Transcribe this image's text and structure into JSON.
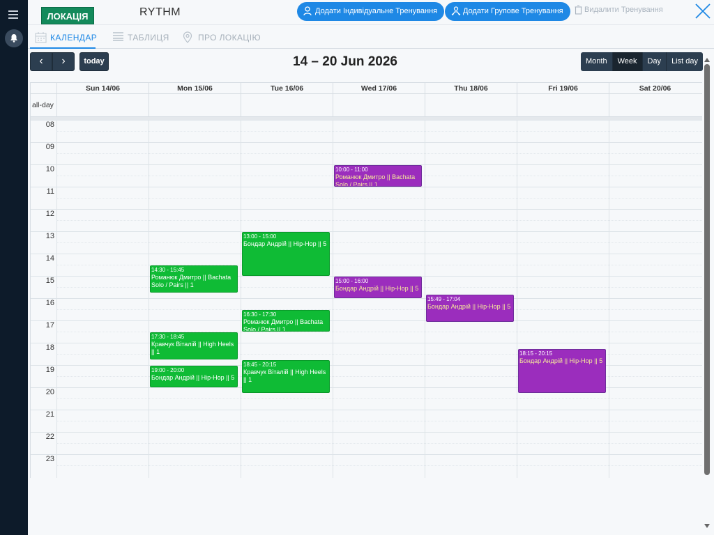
{
  "header": {
    "location_badge": "ЛОКАЦІЯ",
    "app_title": "RYTHM",
    "add_individual": "Додати Індивідуальне Тренування",
    "add_group": "Додати Групове Тренування",
    "delete_training": "Видалити Тренування"
  },
  "tabs": [
    {
      "label": "КАЛЕНДАР",
      "icon": "calendar-icon",
      "active": true
    },
    {
      "label": "ТАБЛИЦЯ",
      "icon": "table-icon",
      "active": false
    },
    {
      "label": "ПРО ЛОКАЦІЮ",
      "icon": "location-pin-icon",
      "active": false
    }
  ],
  "toolbar": {
    "prev": "‹",
    "next": "›",
    "today": "today",
    "title": "14 – 20 Jun 2026",
    "views": [
      "Month",
      "Week",
      "Day",
      "List day"
    ],
    "active_view": "Week"
  },
  "calendar": {
    "allday_label": "all-day",
    "days": [
      "Sun 14/06",
      "Mon 15/06",
      "Tue 16/06",
      "Wed 17/06",
      "Thu 18/06",
      "Fri 19/06",
      "Sat 20/06"
    ],
    "hours": [
      "08",
      "09",
      "10",
      "11",
      "12",
      "13",
      "14",
      "15",
      "16",
      "17",
      "18",
      "19",
      "20",
      "21",
      "22",
      "23"
    ],
    "events": [
      {
        "day": 3,
        "start": "10:00",
        "end": "11:00",
        "time": "10:00 - 11:00",
        "title": "Романюк Дмитро || Bachata Solo / Pairs || 1",
        "color": "purple"
      },
      {
        "day": 2,
        "start": "13:00",
        "end": "15:00",
        "time": "13:00 - 15:00",
        "title": "Бондар Андрій || Hip-Hop || 5",
        "color": "green"
      },
      {
        "day": 1,
        "start": "14:30",
        "end": "15:45",
        "time": "14:30 - 15:45",
        "title": "Романюк Дмитро || Bachata Solo / Pairs || 1",
        "color": "green"
      },
      {
        "day": 3,
        "start": "15:00",
        "end": "16:00",
        "time": "15:00 - 16:00",
        "title": "Бондар Андрій || Hip-Hop || 5",
        "color": "purple"
      },
      {
        "day": 4,
        "start": "15:49",
        "end": "17:04",
        "time": "15:49 - 17:04",
        "title": "Бондар Андрій || Hip-Hop || 5",
        "color": "purple"
      },
      {
        "day": 2,
        "start": "16:30",
        "end": "17:30",
        "time": "16:30 - 17:30",
        "title": "Романюк Дмитро || Bachata Solo / Pairs || 1",
        "color": "green"
      },
      {
        "day": 1,
        "start": "17:30",
        "end": "18:45",
        "time": "17:30 - 18:45",
        "title": "Кравчук Віталій || High Heels || 1",
        "color": "green"
      },
      {
        "day": 5,
        "start": "18:15",
        "end": "20:15",
        "time": "18:15 - 20:15",
        "title": "Бондар Андрій || Hip-Hop || 5",
        "color": "purple"
      },
      {
        "day": 2,
        "start": "18:45",
        "end": "20:15",
        "time": "18:45 - 20:15",
        "title": "Кравчук Віталій || High Heels || 1",
        "color": "green"
      },
      {
        "day": 1,
        "start": "19:00",
        "end": "20:00",
        "time": "19:00 - 20:00",
        "title": "Бондар Андрій || Hip-Hop || 5",
        "color": "green"
      }
    ]
  },
  "colors": {
    "accent": "#1e88e5",
    "brand": "#138a5b",
    "sidebar": "#0d1b2a",
    "event_green": "#0fbb35",
    "event_purple": "#9b2dbd"
  }
}
